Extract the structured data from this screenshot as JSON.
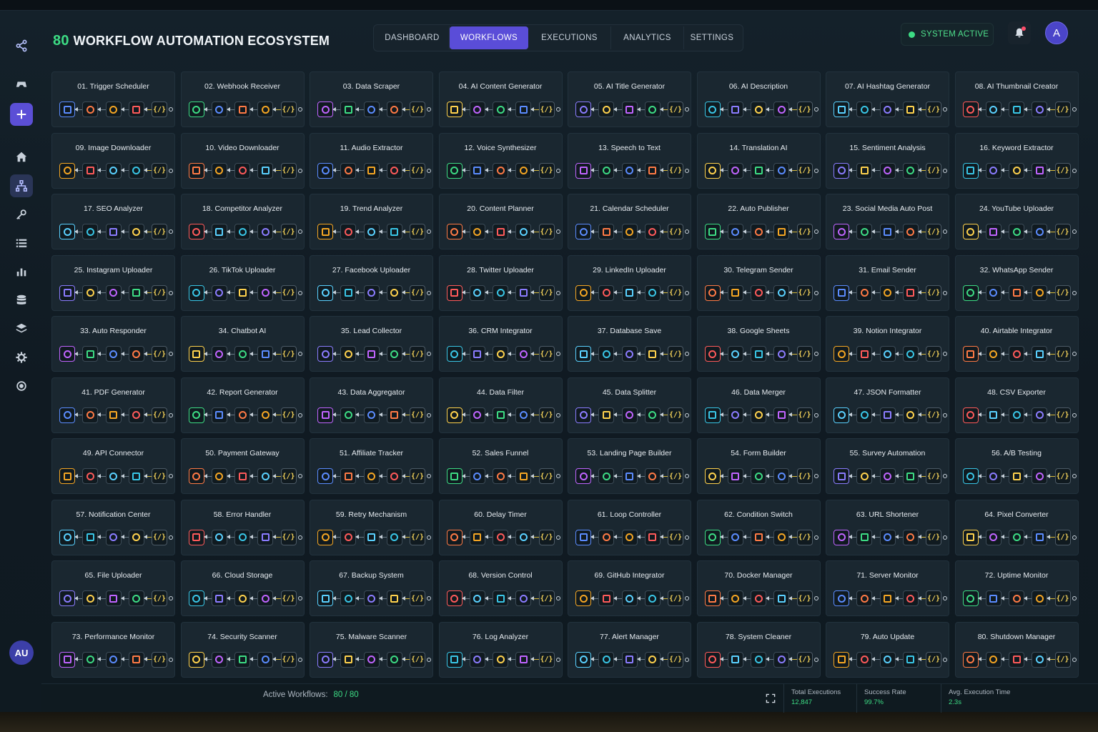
{
  "app": {
    "count": "80",
    "title": "WORKFLOW AUTOMATION ECOSYSTEM"
  },
  "nav": [
    "DASHBOARD",
    "WORKFLOWS",
    "EXECUTIONS",
    "ANALYTICS",
    "SETTINGS"
  ],
  "nav_active": 1,
  "status": "SYSTEM ACTIVE",
  "avatar": "A",
  "sidebar_avatar": "AU",
  "colors": {
    "accent": "#5a4dd8",
    "success": "#3ddc84",
    "code": "#f5d35a"
  },
  "workflows": [
    "01. Trigger Scheduler",
    "02. Webhook Receiver",
    "03. Data Scraper",
    "04. AI Content Generator",
    "05. AI Title Generator",
    "06. AI Description",
    "07. AI Hashtag Generator",
    "08. AI Thumbnail Creator",
    "09. Image Downloader",
    "10. Video Downloader",
    "11. Audio Extractor",
    "12. Voice Synthesizer",
    "13. Speech to Text",
    "14. Translation AI",
    "15. Sentiment Analysis",
    "16. Keyword Extractor",
    "17. SEO Analyzer",
    "18. Competitor Analyzer",
    "19. Trend Analyzer",
    "20. Content Planner",
    "21. Calendar Scheduler",
    "22. Auto Publisher",
    "23. Social Media Auto Post",
    "24. YouTube Uploader",
    "25. Instagram Uploader",
    "26. TikTok Uploader",
    "27. Facebook Uploader",
    "28. Twitter Uploader",
    "29. LinkedIn Uploader",
    "30. Telegram Sender",
    "31. Email Sender",
    "32. WhatsApp Sender",
    "33. Auto Responder",
    "34. Chatbot AI",
    "35. Lead Collector",
    "36. CRM Integrator",
    "37. Database Save",
    "38. Google Sheets",
    "39. Notion Integrator",
    "40. Airtable Integrator",
    "41. PDF Generator",
    "42. Report Generator",
    "43. Data Aggregator",
    "44. Data Filter",
    "45. Data Splitter",
    "46. Data Merger",
    "47. JSON Formatter",
    "48. CSV Exporter",
    "49. API Connector",
    "50. Payment Gateway",
    "51. Affiliate Tracker",
    "52. Sales Funnel",
    "53. Landing Page Builder",
    "54. Form Builder",
    "55. Survey Automation",
    "56. A/B Testing",
    "57. Notification Center",
    "58. Error Handler",
    "59. Retry Mechanism",
    "60. Delay Timer",
    "61. Loop Controller",
    "62. Condition Switch",
    "63. URL Shortener",
    "64. Pixel Converter",
    "65. File Uploader",
    "66. Cloud Storage",
    "67. Backup System",
    "68. Version Control",
    "69. GitHub Integrator",
    "70. Docker Manager",
    "71. Server Monitor",
    "72. Uptime Monitor",
    "73. Performance Monitor",
    "74. Security Scanner",
    "75. Malware Scanner",
    "76. Log Analyzer",
    "77. Alert Manager",
    "78. System Cleaner",
    "79. Auto Update",
    "80. Shutdown Manager"
  ],
  "node_colors": [
    "#5b8cff",
    "#ff5a5a",
    "#8b7cff",
    "#3ddc84",
    "#f5a623",
    "#39c6e6",
    "#c064ff",
    "#ff7a45",
    "#5ad1ff",
    "#ffd24d"
  ],
  "code_glyph": "{/}",
  "footer": {
    "active_label": "Active Workflows:",
    "active_value": "80 / 80",
    "stats": [
      {
        "label": "Total Executions",
        "value": "12,847"
      },
      {
        "label": "Success Rate",
        "value": "99.7%"
      },
      {
        "label": "Avg. Execution Time",
        "value": "2.3s"
      }
    ]
  }
}
